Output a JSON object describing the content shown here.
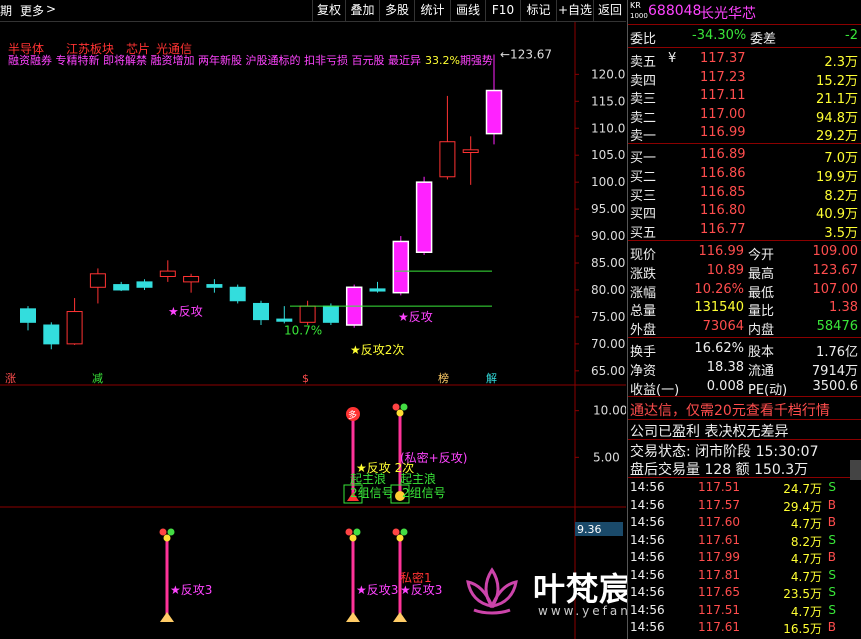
{
  "toolbar": {
    "period": "期",
    "more": "更多",
    "more_arrow": ">",
    "buttons": [
      "复权",
      "叠加",
      "多股",
      "统计",
      "画线",
      "F10",
      "标记",
      "+自选",
      "返回"
    ]
  },
  "header_tags": [
    "半导体",
    "江苏板块",
    "芯片",
    "光通信"
  ],
  "header_concepts": "融资融券 专精特新 即将解禁 融资增加 两年新股 沪股通标的 扣非亏损 百元股 最近异",
  "header_pct": "33.2%",
  "header_suffix": "期强势",
  "chart_data": [
    {
      "type": "candlestick",
      "title": "",
      "ylim": [
        62,
        126
      ],
      "yticks": [
        120.0,
        115.0,
        110.0,
        105.0,
        100.0,
        95.0,
        90.0,
        85.0,
        80.0,
        75.0,
        70.0,
        65.0
      ],
      "max_label": "123.67",
      "candles": [
        {
          "o": 76.5,
          "c": 74.0,
          "h": 77.0,
          "l": 72.5,
          "color": "cyan"
        },
        {
          "o": 73.5,
          "c": 70.0,
          "h": 74.0,
          "l": 69.0,
          "color": "cyan"
        },
        {
          "o": 70.0,
          "c": 76.0,
          "h": 78.5,
          "l": 69.8,
          "color": "red"
        },
        {
          "o": 80.5,
          "c": 83.0,
          "h": 84.0,
          "l": 77.5,
          "color": "red"
        },
        {
          "o": 81.0,
          "c": 80.0,
          "h": 81.5,
          "l": 79.8,
          "color": "cyan"
        },
        {
          "o": 80.5,
          "c": 81.5,
          "h": 82.0,
          "l": 80.0,
          "color": "cyan"
        },
        {
          "o": 82.5,
          "c": 83.5,
          "h": 85.5,
          "l": 81.5,
          "color": "red"
        },
        {
          "o": 82.5,
          "c": 81.5,
          "h": 83.0,
          "l": 79.5,
          "color": "red"
        },
        {
          "o": 81.0,
          "c": 80.5,
          "h": 82.0,
          "l": 79.5,
          "color": "cyan"
        },
        {
          "o": 80.5,
          "c": 78.0,
          "h": 81.0,
          "l": 77.5,
          "color": "cyan"
        },
        {
          "o": 77.5,
          "c": 74.5,
          "h": 78.0,
          "l": 73.5,
          "color": "cyan"
        },
        {
          "o": 74.2,
          "c": 74.6,
          "h": 77.0,
          "l": 73.8,
          "color": "cyan"
        },
        {
          "o": 74.0,
          "c": 77.0,
          "h": 78.0,
          "l": 73.5,
          "color": "red"
        },
        {
          "o": 77.0,
          "c": 74.0,
          "h": 77.5,
          "l": 73.5,
          "color": "cyan"
        },
        {
          "o": 73.5,
          "c": 80.5,
          "h": 81.0,
          "l": 73.0,
          "color": "magenta"
        },
        {
          "o": 80.2,
          "c": 79.8,
          "h": 81.5,
          "l": 79.5,
          "color": "cyan"
        },
        {
          "o": 79.5,
          "c": 89.0,
          "h": 90.0,
          "l": 79.0,
          "color": "magenta"
        },
        {
          "o": 87.0,
          "c": 100.0,
          "h": 101.0,
          "l": 86.5,
          "color": "magenta"
        },
        {
          "o": 101.0,
          "c": 107.5,
          "h": 116.0,
          "l": 100.5,
          "color": "red"
        },
        {
          "o": 105.5,
          "c": 106.0,
          "h": 108.5,
          "l": 99.5,
          "color": "red"
        },
        {
          "o": 109.0,
          "c": 117.0,
          "h": 123.67,
          "l": 107.0,
          "color": "magenta"
        }
      ]
    },
    {
      "type": "indicator",
      "yticks": [
        10.0,
        5.0
      ]
    },
    {
      "type": "indicator",
      "value_label": "9.36"
    }
  ],
  "chart_labels": {
    "fangong1": "★反攻",
    "pct": "10.7%",
    "fangong2": "★反攻2次",
    "fangong3": "★反攻",
    "markers_bottom": [
      "涨",
      "减",
      "$",
      "榜",
      "解"
    ],
    "ind_labels": [
      "★反攻 2次",
      "(私密+反攻)",
      "起主浪",
      "起主浪",
      "2组信号",
      "2组信号"
    ],
    "ind_duo": "多",
    "sig_labels": [
      "★反攻3",
      "★反攻3",
      "私密1",
      "★反攻3"
    ]
  },
  "watermark": {
    "title": "叶梵宸指标公式网",
    "url": "www.yefanchen.com"
  },
  "stock": {
    "market": "KR",
    "market_sub": "1000",
    "code": "688048",
    "name": "长光华芯"
  },
  "weibi": {
    "label": "委比",
    "value": "-34.30%",
    "diff_label": "委差",
    "diff_value": "-2"
  },
  "sell": [
    {
      "label": "卖五",
      "mark": "¥",
      "price": "117.37",
      "vol": "2.3万"
    },
    {
      "label": "卖四",
      "mark": "",
      "price": "117.23",
      "vol": "15.2万"
    },
    {
      "label": "卖三",
      "mark": "",
      "price": "117.11",
      "vol": "21.1万"
    },
    {
      "label": "卖二",
      "mark": "",
      "price": "117.00",
      "vol": "94.8万"
    },
    {
      "label": "卖一",
      "mark": "",
      "price": "116.99",
      "vol": "29.2万"
    }
  ],
  "buy": [
    {
      "label": "买一",
      "price": "116.89",
      "vol": "7.0万"
    },
    {
      "label": "买二",
      "price": "116.86",
      "vol": "19.9万"
    },
    {
      "label": "买三",
      "price": "116.85",
      "vol": "8.2万"
    },
    {
      "label": "买四",
      "price": "116.80",
      "vol": "40.9万"
    },
    {
      "label": "买五",
      "price": "116.77",
      "vol": "3.5万"
    }
  ],
  "stats": [
    {
      "l1": "现价",
      "v1": "116.99",
      "l2": "今开",
      "v2": "109.00"
    },
    {
      "l1": "涨跌",
      "v1": "10.89",
      "l2": "最高",
      "v2": "123.67"
    },
    {
      "l1": "涨幅",
      "v1": "10.26%",
      "l2": "最低",
      "v2": "107.00"
    },
    {
      "l1": "总量",
      "v1": "131540",
      "l2": "量比",
      "v2": "1.38"
    },
    {
      "l1": "外盘",
      "v1": "73064",
      "l2": "内盘",
      "v2": "58476"
    }
  ],
  "stats2": [
    {
      "l1": "换手",
      "v1": "16.62%",
      "l2": "股本",
      "v2": "1.76亿"
    },
    {
      "l1": "净资",
      "v1": "18.38",
      "l2": "流通",
      "v2": "7914万"
    },
    {
      "l1": "收益(一)",
      "v1": "0.008",
      "l2": "PE(动)",
      "v2": "3500.6"
    }
  ],
  "notice": "通达信，仅需20元查看千档行情",
  "company": "公司已盈利 表决权无差异",
  "trade_status": "交易状态: 闭市阶段 15:30:07",
  "after_hours": "盘后交易量 128 额 150.3万",
  "ticks": [
    {
      "t": "14:56",
      "p": "117.51",
      "v": "24.7万",
      "s": "S"
    },
    {
      "t": "14:56",
      "p": "117.57",
      "v": "29.4万",
      "s": "B"
    },
    {
      "t": "14:56",
      "p": "117.60",
      "v": "4.7万",
      "s": "B"
    },
    {
      "t": "14:56",
      "p": "117.61",
      "v": "8.2万",
      "s": "S"
    },
    {
      "t": "14:56",
      "p": "117.99",
      "v": "4.7万",
      "s": "B"
    },
    {
      "t": "14:56",
      "p": "117.81",
      "v": "4.7万",
      "s": "S"
    },
    {
      "t": "14:56",
      "p": "117.65",
      "v": "23.5万",
      "s": "S"
    },
    {
      "t": "14:56",
      "p": "117.51",
      "v": "4.7万",
      "s": "S"
    },
    {
      "t": "14:56",
      "p": "117.61",
      "v": "16.5万",
      "s": "B"
    }
  ],
  "colors": {
    "up": "#ff3333",
    "down": "#33dddd",
    "magenta": "#ff22ff",
    "panel_sep": "#8b0000"
  }
}
